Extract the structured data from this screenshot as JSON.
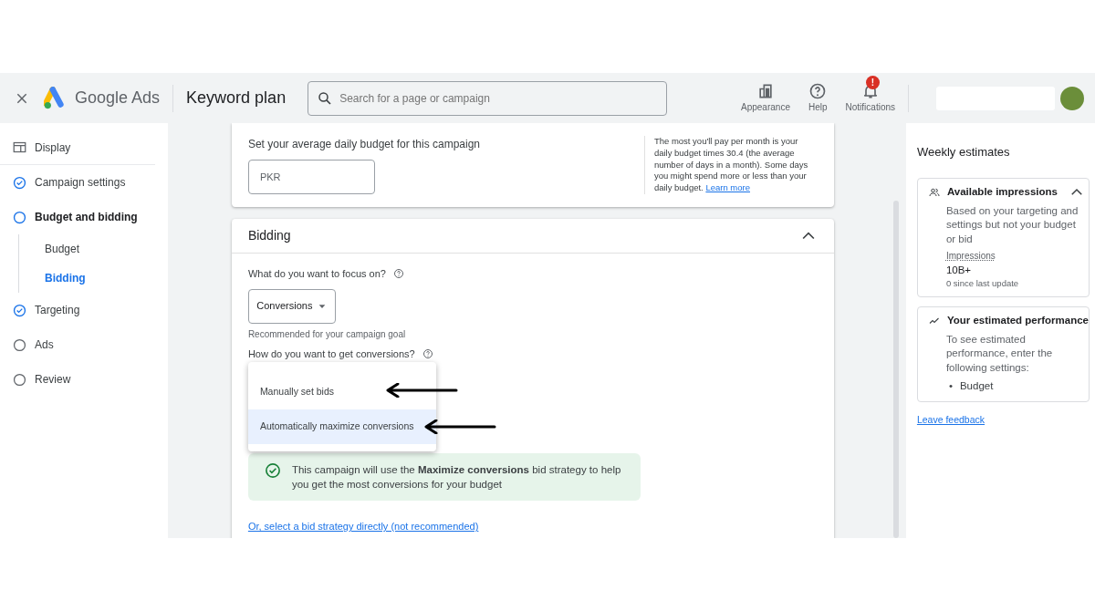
{
  "header": {
    "product": "Google Ads",
    "page_title": "Keyword plan",
    "search": {
      "placeholder": "Search for a page or campaign"
    },
    "actions": [
      {
        "kind": "appearance",
        "label": "Appearance",
        "alert": false
      },
      {
        "kind": "help",
        "label": "Help",
        "alert": false
      },
      {
        "kind": "notifications",
        "label": "Notifications",
        "alert": true,
        "badge": "!"
      }
    ]
  },
  "sidebar": {
    "display": "Display",
    "items": [
      {
        "label": "Campaign settings",
        "done": true,
        "current": false
      },
      {
        "label": "Budget and bidding",
        "done": false,
        "current": true,
        "children": [
          {
            "label": "Budget",
            "selected": false
          },
          {
            "label": "Bidding",
            "selected": true
          }
        ]
      },
      {
        "label": "Targeting",
        "done": true,
        "current": false
      },
      {
        "label": "Ads",
        "done": false,
        "current": false
      },
      {
        "label": "Review",
        "done": false,
        "current": false
      }
    ]
  },
  "budget": {
    "label": "Set your average daily budget for this campaign",
    "currency": "PKR",
    "note": "The most you'll pay per month is your daily budget times 30.4 (the average number of days in a month). Some days you might spend more or less than your daily budget.",
    "note_link": "Learn more"
  },
  "bidding": {
    "title": "Bidding",
    "expanded": true,
    "focus_question": "What do you want to focus on?",
    "focus_value": "Conversions",
    "focus_hint": "Recommended for your campaign goal",
    "how_question": "How do you want to get conversions?",
    "options": [
      {
        "label": "Manually set bids",
        "selected": false
      },
      {
        "label": "Automatically maximize conversions",
        "selected": true
      }
    ],
    "info": "This campaign will use the **Maximize conversions** bid strategy to help you get the most conversions for your budget",
    "direct_link": "Or, select a bid strategy directly (not recommended)"
  },
  "estimates": {
    "title": "Weekly estimates",
    "impressions": {
      "title": "Available impressions",
      "expanded": true,
      "text": "Based on your targeting and settings but not your budget or bid",
      "metric_label": "Impressions",
      "metric_value": "10B+",
      "metric_note": "0 since last update"
    },
    "performance": {
      "title": "Your estimated performance",
      "text": "To see estimated performance, enter the following settings:",
      "settings": [
        {
          "marker": "•",
          "label": "Budget"
        }
      ]
    },
    "feedback": "Leave feedback"
  }
}
